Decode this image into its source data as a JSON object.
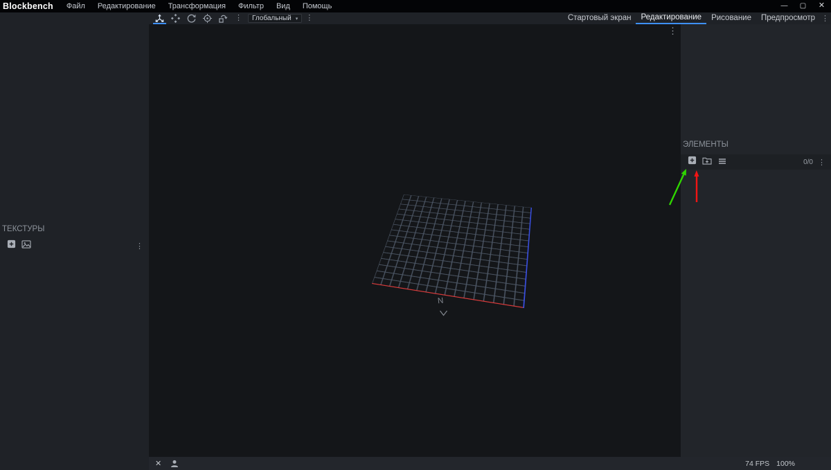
{
  "titlebar": {
    "app_name": "Blockbench",
    "menus": [
      "Файл",
      "Редактирование",
      "Трансформация",
      "Фильтр",
      "Вид",
      "Помощь"
    ],
    "window_controls": {
      "minimize": "—",
      "maximize": "▢",
      "close": "✕"
    }
  },
  "topbar": {
    "tools": [
      "move-tool",
      "resize-tool",
      "rotate-tool",
      "pivot-tool",
      "vertex-snap-tool"
    ],
    "active_tool": "move-tool",
    "space_dropdown": {
      "value": "Глобальный",
      "caret": "▾"
    },
    "overflow_glyph": "⋮"
  },
  "tabbar": {
    "tabs": [
      {
        "label": "Стартовый экран",
        "active": false
      },
      {
        "label": "Редактирование",
        "active": true
      },
      {
        "label": "Рисование",
        "active": false
      },
      {
        "label": "Предпросмотр",
        "active": false
      }
    ],
    "menu_glyph": "⋮"
  },
  "left_panel": {
    "textures": {
      "title": "ТЕКСТУРЫ",
      "menu_glyph": "⋮"
    }
  },
  "right_panel": {
    "elements": {
      "title": "ЭЛЕМЕНТЫ",
      "counter": "0/0",
      "menu_glyph": "⋮"
    }
  },
  "viewport": {
    "north_label": "N",
    "menu_glyph": "⋮",
    "grid_divisions": 16
  },
  "statusbar": {
    "close_glyph": "✕",
    "fps": "74 FPS",
    "zoom": "100%"
  },
  "annotations": {
    "green_arrow": "points-to-add-cube-button",
    "red_arrow": "points-to-add-group-button"
  },
  "colors": {
    "accent_blue": "#3e90ff",
    "grid_line": "#4d5766",
    "axis_x_red": "#e23c3c",
    "axis_z_blue": "#3a50e8",
    "annotation_green": "#2fd500",
    "annotation_red": "#f21414"
  }
}
